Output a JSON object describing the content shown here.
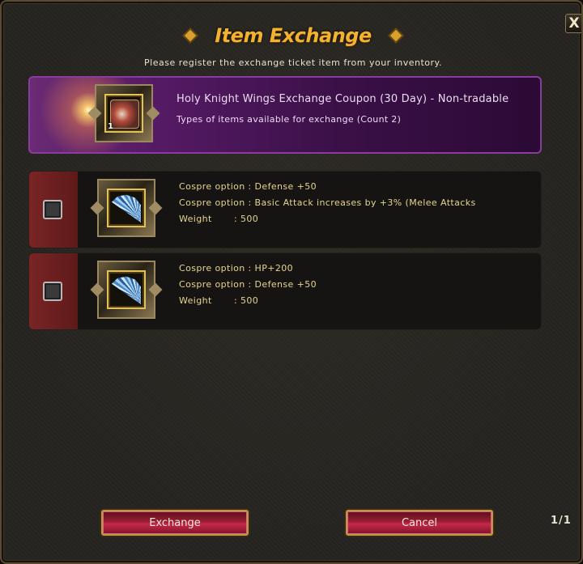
{
  "window": {
    "title": "Item Exchange",
    "subtitle": "Please register the exchange ticket item from your inventory.",
    "close_label": "X"
  },
  "coupon": {
    "name": "Holy Knight Wings Exchange Coupon (30 Day) - Non-tradable",
    "description": "Types of items available for exchange (Count 2)",
    "count": "1",
    "icon": "coupon-icon"
  },
  "options": [
    {
      "icon": "wings-icon",
      "checked": false,
      "lines": [
        "Cospre option : Defense +50",
        "Cospre option : Basic Attack increases by +3% (Melee Attacks",
        "Weight       : 500"
      ]
    },
    {
      "icon": "wings-icon",
      "checked": false,
      "lines": [
        "Cospre option : HP+200",
        "Cospre option : Defense +50",
        "Weight       : 500"
      ]
    }
  ],
  "buttons": {
    "exchange": "Exchange",
    "cancel": "Cancel"
  },
  "pagination": "1/1",
  "colors": {
    "title": "#f2b12e",
    "option_text": "#e6d58e",
    "coupon_border": "#8a3c9e",
    "button_red": "#c62848"
  }
}
